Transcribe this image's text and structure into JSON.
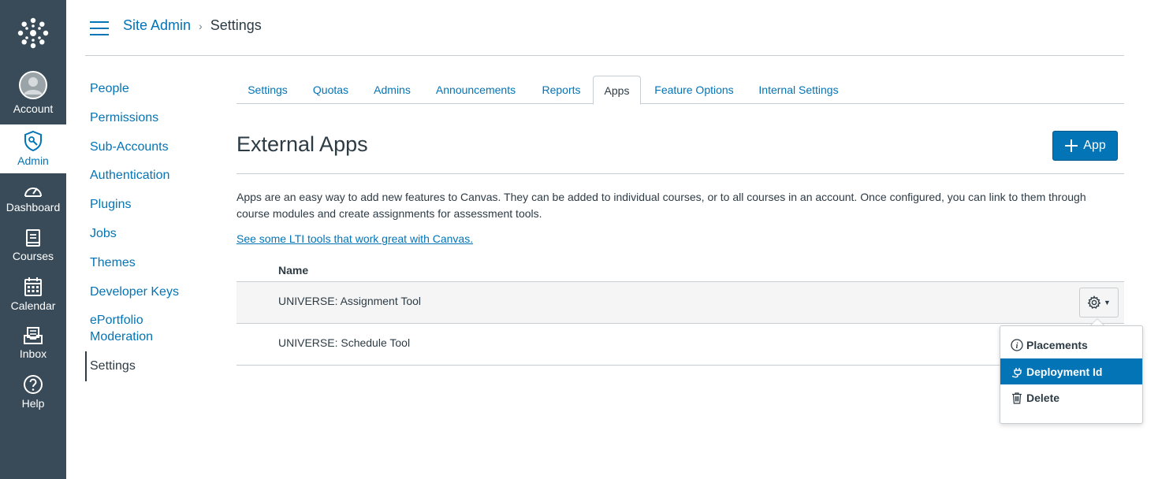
{
  "global_nav": {
    "items": [
      {
        "label": "Account"
      },
      {
        "label": "Admin"
      },
      {
        "label": "Dashboard"
      },
      {
        "label": "Courses"
      },
      {
        "label": "Calendar"
      },
      {
        "label": "Inbox"
      },
      {
        "label": "Help"
      }
    ],
    "accent": "#0374b5",
    "bg": "#394b58"
  },
  "breadcrumb": {
    "root": "Site Admin",
    "current": "Settings"
  },
  "side_nav": {
    "items": [
      {
        "label": "People"
      },
      {
        "label": "Permissions"
      },
      {
        "label": "Sub-Accounts"
      },
      {
        "label": "Authentication"
      },
      {
        "label": "Plugins"
      },
      {
        "label": "Jobs"
      },
      {
        "label": "Themes"
      },
      {
        "label": "Developer Keys"
      },
      {
        "label": "ePortfolio"
      },
      {
        "label": "Moderation"
      },
      {
        "label": "Settings"
      }
    ]
  },
  "tabs": [
    {
      "label": "Settings"
    },
    {
      "label": "Quotas"
    },
    {
      "label": "Admins"
    },
    {
      "label": "Announcements"
    },
    {
      "label": "Reports"
    },
    {
      "label": "Apps"
    },
    {
      "label": "Feature Options"
    },
    {
      "label": "Internal Settings"
    }
  ],
  "main": {
    "title": "External Apps",
    "add_button": "App",
    "description": "Apps are an easy way to add new features to Canvas. They can be added to individual courses, or to all courses in an account. Once configured, you can link to them through course modules and create assignments for assessment tools.",
    "lti_link": "See some LTI tools that work great with Canvas.",
    "table": {
      "header": "Name",
      "rows": [
        {
          "name": "UNIVERSE: Assignment Tool"
        },
        {
          "name": "UNIVERSE: Schedule Tool"
        }
      ]
    }
  },
  "menu": {
    "items": [
      {
        "label": "Placements",
        "icon": "info-icon"
      },
      {
        "label": "Deployment Id",
        "icon": "plug-icon"
      },
      {
        "label": "Delete",
        "icon": "trash-icon"
      }
    ]
  }
}
